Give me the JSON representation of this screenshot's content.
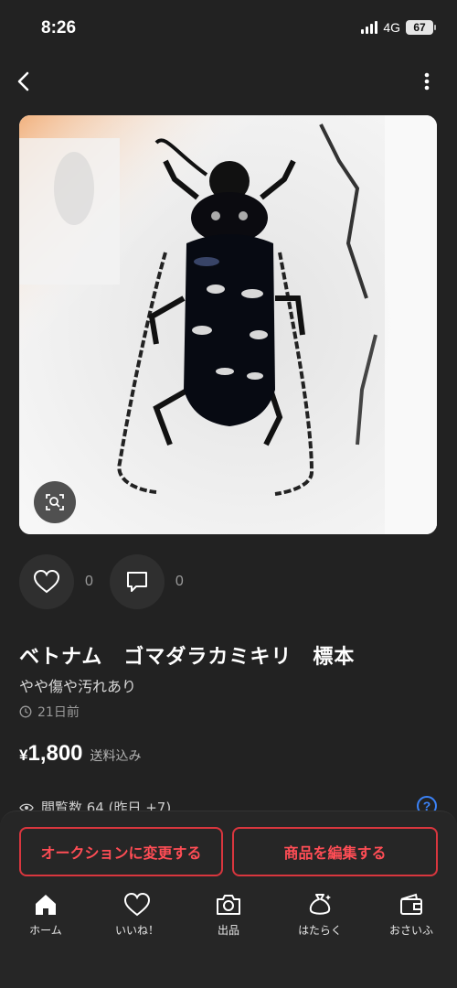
{
  "status_bar": {
    "time": "8:26",
    "network": "4G",
    "battery": "67"
  },
  "item": {
    "title": "ベトナム　ゴマダラカミキリ　標本",
    "condition": "やや傷や汚れあり",
    "posted": "21日前",
    "price_symbol": "¥",
    "price": "1,800",
    "shipping_note": "送料込み",
    "likes": "0",
    "comments": "0",
    "views": "閲覧数  64 (昨日 +7)",
    "help_label": "?"
  },
  "actions": {
    "auction_label": "オークションに変更する",
    "edit_label": "商品を編集する"
  },
  "tabs": [
    {
      "label": "ホーム",
      "icon": "home-icon"
    },
    {
      "label": "いいね！",
      "icon": "heart-icon"
    },
    {
      "label": "出品",
      "icon": "camera-icon"
    },
    {
      "label": "はたらく",
      "icon": "money-bag-icon"
    },
    {
      "label": "おさいふ",
      "icon": "wallet-icon"
    }
  ],
  "colors": {
    "background": "#222222",
    "accent_red": "#d9363e",
    "help_blue": "#3b82f6"
  }
}
